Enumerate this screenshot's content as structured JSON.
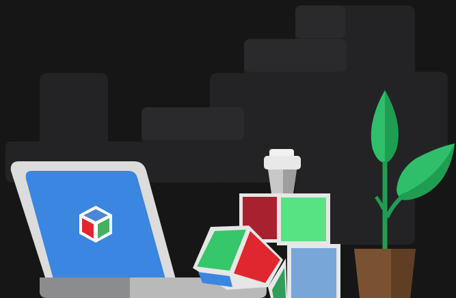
{
  "scene": {
    "background_color": "#161616",
    "block_color": "#232325",
    "block_color_light": "#2a2a2c",
    "laptop": {
      "frame_color": "#dcdcdc",
      "screen_color": "#3a86e0",
      "base_color": "#b9b9b9",
      "logo_icon": "app-cube-logo-icon",
      "logo_colors": [
        "#3fb35f",
        "#e0262f",
        "#4c86d8",
        "#ffffff"
      ]
    },
    "cup": {
      "icon": "coffee-cup-icon",
      "color": "#e8e8e8"
    },
    "cubes": [
      {
        "icon": "red-block-icon",
        "color": "#a7222e"
      },
      {
        "icon": "green-block-icon",
        "color": "#57e283"
      },
      {
        "icon": "blue-block-icon",
        "color": "#79a6d8"
      },
      {
        "icon": "tilted-cube-icon",
        "colors": [
          "#35c76a",
          "#e0262f",
          "#3a86e0"
        ]
      }
    ],
    "plant": {
      "icon": "potted-plant-icon",
      "leaf_color": "#2fbf6a",
      "leaf_dark": "#1f9e52",
      "pot_color": "#7a5232"
    }
  }
}
